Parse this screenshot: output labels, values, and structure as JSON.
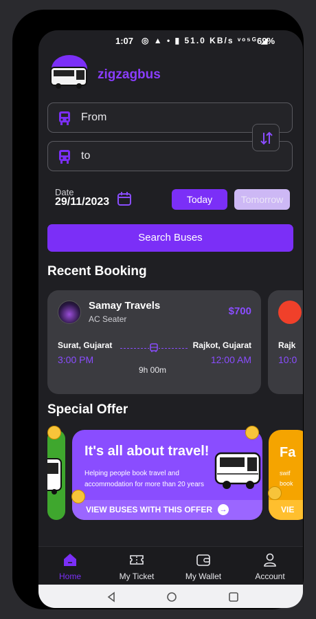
{
  "status_bar": {
    "time": "1:07",
    "icons": "◎ ▲ • ▮ 51.0 KB/s ᵛᵒ⁵ᴳ ◢",
    "battery": "69%"
  },
  "brand": {
    "name": "zigzagbus"
  },
  "search": {
    "from_label": "From",
    "to_label": "to",
    "date_label": "Date",
    "date_value": "29/11/2023",
    "today_label": "Today",
    "tomorrow_label": "Tomorrow",
    "search_button": "Search Buses"
  },
  "recent_booking": {
    "title": "Recent Booking",
    "card": {
      "operator": "Samay Travels",
      "seat_type": "AC Seater",
      "price": "$700",
      "from_city": "Surat, Gujarat",
      "from_time": "3:00 PM",
      "to_city": "Rajkot, Gujarat",
      "to_time": "12:00 AM",
      "duration": "9h 00m"
    },
    "peek_card": {
      "city": "Rajk",
      "time": "10:0"
    }
  },
  "special_offer": {
    "title": "Special Offer",
    "main": {
      "headline": "It's all about travel!",
      "description": "Helping people book travel and accommodation for more than 20 years",
      "cta": "VIEW BUSES WITH THIS OFFER"
    },
    "peek_right": {
      "headline": "Fa",
      "line1": "swif",
      "line2": "book",
      "cta": "VIE"
    }
  },
  "bottom_nav": {
    "items": [
      {
        "label": "Home",
        "icon": "home-icon",
        "active": true
      },
      {
        "label": "My Ticket",
        "icon": "ticket-icon",
        "active": false
      },
      {
        "label": "My Wallet",
        "icon": "wallet-icon",
        "active": false
      },
      {
        "label": "Account",
        "icon": "account-icon",
        "active": false
      }
    ]
  },
  "colors": {
    "accent": "#7b2ff7",
    "background": "#1f1f23",
    "card": "#3b3b40"
  }
}
